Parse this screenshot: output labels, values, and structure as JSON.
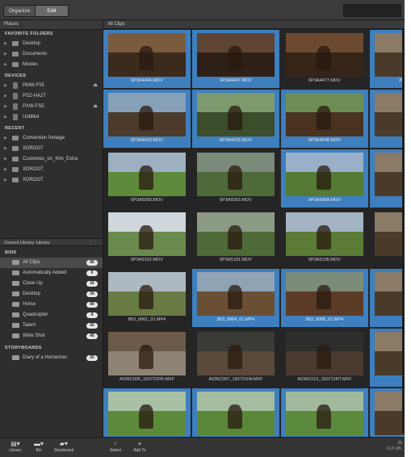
{
  "tabs": {
    "organize": "Organize",
    "edit": "Edit"
  },
  "sidebar": {
    "header": "Places",
    "favorites_heading": "FAVORITE FOLDERS",
    "favorites": [
      "Desktop",
      "Documents",
      "Movies"
    ],
    "devices_heading": "DEVICES",
    "devices": [
      {
        "label": "PMW-F55",
        "eject": true
      },
      {
        "label": "PSZ-HA2T",
        "eject": false
      },
      {
        "label": "PXW-FS5",
        "eject": true
      },
      {
        "label": "Untitled",
        "eject": false
      }
    ],
    "recent_heading": "RECENT",
    "recent": [
      "Convention footage",
      "XDROOT",
      "Customes_on_Klm_Extra",
      "XDROOT",
      "XDROOT"
    ],
    "current_library": "Current Library: Library",
    "bins_heading": "BINS",
    "bins": [
      {
        "label": "All Clips",
        "count": "80"
      },
      {
        "label": "Automatically Added",
        "count": "0"
      },
      {
        "label": "Close Up",
        "count": "16"
      },
      {
        "label": "Desktop",
        "count": "34"
      },
      {
        "label": "Horse",
        "count": "49"
      },
      {
        "label": "Quadcopter",
        "count": "4"
      },
      {
        "label": "Talent",
        "count": "42"
      },
      {
        "label": "Wide Shot",
        "count": "45"
      }
    ],
    "storyboards_heading": "STORYBOARDS",
    "storyboards": [
      {
        "label": "Diary of a Horseman",
        "count": "20"
      }
    ]
  },
  "main": {
    "header": "All Clips",
    "clips": [
      {
        "name": "6P3A4446.MOV",
        "selected": true
      },
      {
        "name": "6P3A4447.MOV",
        "selected": true
      },
      {
        "name": "6P3A4477.MOV",
        "selected": false
      },
      {
        "name": "6P3A4623.MOV",
        "selected": true
      },
      {
        "name": "6P3A4626.MOV",
        "selected": true
      },
      {
        "name": "6P3A4648.MOV",
        "selected": true
      },
      {
        "name": "6P3A5050.MOV",
        "selected": false
      },
      {
        "name": "6P3A5053.MOV",
        "selected": false
      },
      {
        "name": "6P3A5054.MOV",
        "selected": true
      },
      {
        "name": "6P3A5162.MOV",
        "selected": false
      },
      {
        "name": "6P3A5191.MOV",
        "selected": false
      },
      {
        "name": "6P3A5195.MOV",
        "selected": false
      },
      {
        "name": "863_0061_01.MP4",
        "selected": false
      },
      {
        "name": "863_0064_01.MP4",
        "selected": true
      },
      {
        "name": "863_0068_01.MP4",
        "selected": true
      },
      {
        "name": "A036C005_150721PR.MXF",
        "selected": false
      },
      {
        "name": "A036C007_150721IW.MXF",
        "selected": false
      },
      {
        "name": "A036C010_150721RT.MXF",
        "selected": false
      },
      {
        "name": "",
        "selected": true
      },
      {
        "name": "",
        "selected": true
      },
      {
        "name": "",
        "selected": true
      }
    ],
    "partial_labels": [
      "25",
      "",
      "",
      "",
      "",
      "",
      "",
      ""
    ]
  },
  "bottombar": {
    "library": "Library",
    "bin": "Bin",
    "storyboard": "Storyboard",
    "select": "Select",
    "add_to": "Add To",
    "stat1": "25",
    "stat2": "19.8 GB,"
  },
  "colors": {
    "selection": "#3e7fbf",
    "background": "#252525"
  }
}
